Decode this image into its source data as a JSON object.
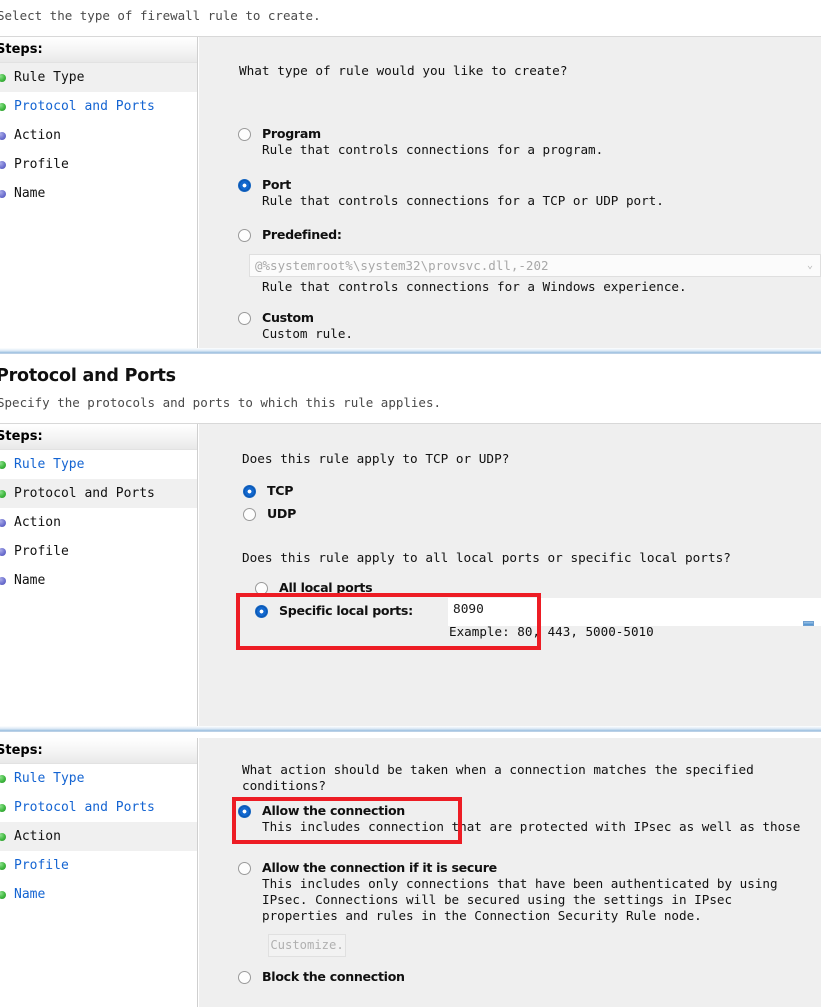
{
  "panel1": {
    "subtitle": "Select the type of firewall rule to create.",
    "steps_header": "Steps:",
    "steps": [
      {
        "label": "Rule Type",
        "state": "current",
        "bullet": "done"
      },
      {
        "label": "Protocol and Ports",
        "state": "link",
        "bullet": "done"
      },
      {
        "label": "Action",
        "state": "plain",
        "bullet": "todo"
      },
      {
        "label": "Profile",
        "state": "plain",
        "bullet": "todo"
      },
      {
        "label": "Name",
        "state": "plain",
        "bullet": "todo"
      }
    ],
    "question": "What type of rule would you like to create?",
    "options": [
      {
        "label": "Program",
        "desc": "Rule that controls connections for a program.",
        "checked": false
      },
      {
        "label": "Port",
        "desc": "Rule that controls connections for a TCP or UDP port.",
        "checked": true
      },
      {
        "label": "Predefined:",
        "desc": "Rule that controls connections for a Windows experience.",
        "checked": false
      },
      {
        "label": "Custom",
        "desc": "Custom rule.",
        "checked": false
      }
    ],
    "predefined_combo_value": "@%systemroot%\\system32\\provsvc.dll,-202",
    "combo_arrow": "⌄"
  },
  "panel2": {
    "title": "Protocol and Ports",
    "subtitle": "Specify the protocols and ports to which this rule applies.",
    "steps_header": "Steps:",
    "steps": [
      {
        "label": "Rule Type",
        "state": "link",
        "bullet": "done"
      },
      {
        "label": "Protocol and Ports",
        "state": "current",
        "bullet": "done"
      },
      {
        "label": "Action",
        "state": "plain",
        "bullet": "todo"
      },
      {
        "label": "Profile",
        "state": "plain",
        "bullet": "todo"
      },
      {
        "label": "Name",
        "state": "plain",
        "bullet": "todo"
      }
    ],
    "question_protocol": "Does this rule apply to TCP or UDP?",
    "protocol_options": [
      {
        "label": "TCP",
        "checked": true
      },
      {
        "label": "UDP",
        "checked": false
      }
    ],
    "question_ports": "Does this rule apply to all local ports or specific local ports?",
    "port_options": [
      {
        "label": "All local ports",
        "checked": false
      },
      {
        "label": "Specific local ports:",
        "checked": true
      }
    ],
    "ports_value": "8090",
    "ports_example": "Example: 80, 443, 5000-5010"
  },
  "panel3": {
    "steps_header": "Steps:",
    "steps": [
      {
        "label": "Rule Type",
        "state": "link",
        "bullet": "done"
      },
      {
        "label": "Protocol and Ports",
        "state": "link",
        "bullet": "done"
      },
      {
        "label": "Action",
        "state": "current",
        "bullet": "done"
      },
      {
        "label": "Profile",
        "state": "link",
        "bullet": "done"
      },
      {
        "label": "Name",
        "state": "link",
        "bullet": "done"
      }
    ],
    "question": "What action should be taken when a connection matches the specified\nconditions?",
    "options": [
      {
        "label": "Allow the connection",
        "desc": "This includes connection  that are protected with IPsec as well as those",
        "checked": true
      },
      {
        "label": "Allow the connection if it is secure",
        "desc": "This includes only connections that have been authenticated by using\nIPsec.  Connections will be secured using the settings in IPsec\nproperties and rules in the Connection Security Rule node.",
        "checked": false
      },
      {
        "label": "Block the connection",
        "desc": "",
        "checked": false
      }
    ],
    "customize_button": "Customize."
  },
  "colors": {
    "highlight_red": "#ed1c24",
    "link_blue": "#1464d2",
    "radio_blue": "#1268cf",
    "step_done_green": "#3fb83f",
    "step_todo_purple": "#6f72d0",
    "content_bg": "#efefef"
  }
}
